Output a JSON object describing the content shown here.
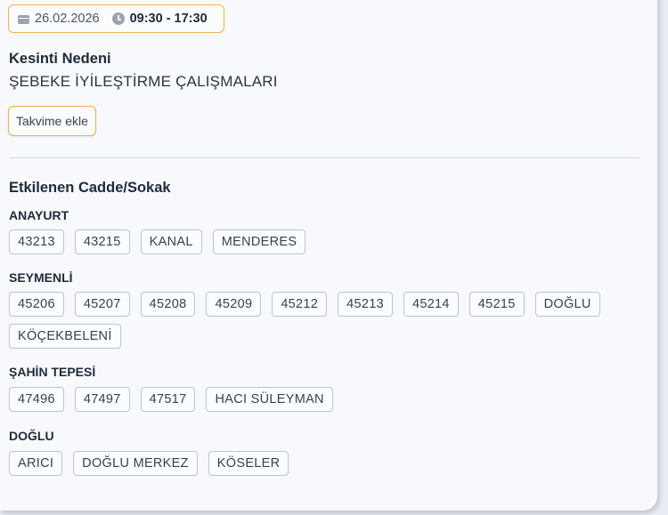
{
  "schedule": {
    "date": "26.02.2026",
    "time": "09:30 - 17:30"
  },
  "reason": {
    "label": "Kesinti Nedeni",
    "value": "ŞEBEKE İYİLEŞTİRME ÇALIŞMALARI"
  },
  "calendar_button": "Takvime ekle",
  "streets": {
    "title": "Etkilenen Cadde/Sokak",
    "groups": [
      {
        "name": "ANAYURT",
        "tags": [
          "43213",
          "43215",
          "KANAL",
          "MENDERES"
        ]
      },
      {
        "name": "SEYMENLİ",
        "tags": [
          "45206",
          "45207",
          "45208",
          "45209",
          "45212",
          "45213",
          "45214",
          "45215",
          "DOĞLU",
          "KÖÇEKBELENİ"
        ]
      },
      {
        "name": "ŞAHİN TEPESİ",
        "tags": [
          "47496",
          "47497",
          "47517",
          "HACI SÜLEYMAN"
        ]
      },
      {
        "name": "DOĞLU",
        "tags": [
          "ARICI",
          "DOĞLU MERKEZ",
          "KÖSELER"
        ]
      }
    ]
  },
  "colors": {
    "accent_border": "#f0b24a",
    "tag_border": "#b9c5d6",
    "card_background": "#f7f9fc"
  }
}
